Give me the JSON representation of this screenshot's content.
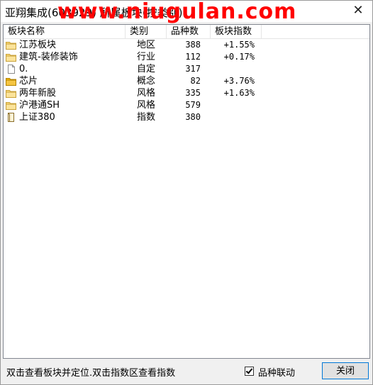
{
  "window": {
    "title": "亚翔集成(603929) 所属板块(按类别)",
    "watermark": "www.niugulan.com"
  },
  "list": {
    "columns": [
      "板块名称",
      "类别",
      "品种数",
      "板块指数"
    ],
    "rows": [
      {
        "icon": "folder-icon",
        "name": "江苏板块",
        "type": "地区",
        "count": "388",
        "index": "+1.55%"
      },
      {
        "icon": "folder-icon",
        "name": "建筑-装修装饰",
        "type": "行业",
        "count": "112",
        "index": "+0.17%"
      },
      {
        "icon": "document-icon",
        "name": "0.",
        "type": "自定",
        "count": "317",
        "index": ""
      },
      {
        "icon": "folder-yellow-icon",
        "name": "芯片",
        "type": "概念",
        "count": "82",
        "index": "+3.76%"
      },
      {
        "icon": "folder-icon",
        "name": "两年新股",
        "type": "风格",
        "count": "335",
        "index": "+1.63%"
      },
      {
        "icon": "folder-icon",
        "name": "沪港通SH",
        "type": "风格",
        "count": "579",
        "index": ""
      },
      {
        "icon": "page-icon",
        "name": "上证380",
        "type": "指数",
        "count": "380",
        "index": ""
      }
    ]
  },
  "footer": {
    "hint": "双击查看板块并定位.双击指数区查看指数",
    "link_checkbox_label": "品种联动",
    "link_checked": true,
    "close_label": "关闭"
  },
  "colors": {
    "folder": "#f5c542",
    "folder_yellow": "#f2b705",
    "watermark": "#ff0000",
    "button_border": "#0078d7"
  }
}
